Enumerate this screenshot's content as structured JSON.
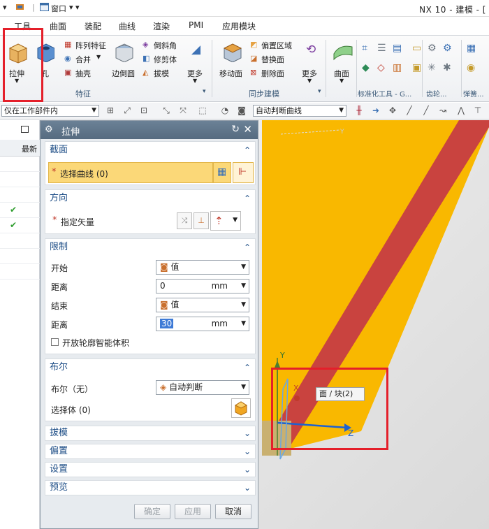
{
  "titlebar": {
    "title": "NX 10 - 建模 - [",
    "window_menu": "窗口"
  },
  "menu_tabs": [
    "工具",
    "曲面",
    "装配",
    "曲线",
    "渲染",
    "PMI",
    "应用模块"
  ],
  "ribbon": {
    "extrude": "拉伸",
    "hole": "孔",
    "pattern_feature": "阵列特征",
    "unite": "合并",
    "shell": "抽壳",
    "feature_group": "特征",
    "edge_blend": "边倒圆",
    "chamfer": "倒斜角",
    "trim_body": "修剪体",
    "draft": "拔模",
    "more1": "更多",
    "move_face": "移动面",
    "offset_region": "偏置区域",
    "replace_face": "替换面",
    "delete_face": "删除面",
    "sync_group": "同步建模",
    "more2": "更多",
    "surface": "曲面",
    "std_group": "标准化工具 - G...",
    "gear_group": "齿轮...",
    "spring_group": "弹簧..."
  },
  "selbar": {
    "filter": "仅在工作部件内",
    "curve_rule": "自动判断曲线"
  },
  "nav": {
    "col_header": "最新",
    "check1": "✔",
    "check2": "✔"
  },
  "dialog": {
    "title": "拉伸",
    "section_label": "截面",
    "select_curve": "选择曲线 (0)",
    "direction_label": "方向",
    "specify_vector": "指定矢量",
    "limits_label": "限制",
    "start_label": "开始",
    "start_value": "值",
    "distance_label": "距离",
    "start_distance": "0",
    "unit1": "mm",
    "end_label": "结束",
    "end_value": "值",
    "end_distance_label": "距离",
    "end_distance": "30",
    "unit2": "mm",
    "open_profile": "开放轮廓智能体积",
    "boolean_label": "布尔",
    "boolean_none": "布尔（无）",
    "boolean_value": "自动判断",
    "select_body": "选择体 (0)",
    "draft": "拔模",
    "offset": "偏置",
    "settings": "设置",
    "preview": "预览",
    "ok": "确定",
    "apply": "应用",
    "cancel": "取消"
  },
  "viewport": {
    "tooltip": "面 / 块(2)",
    "axis_x": "X",
    "axis_y": "Y",
    "axis_z": "Z",
    "axis_y_top": "Y"
  },
  "colors": {
    "face_yellow": "#f9b800",
    "face_red": "#c9433f",
    "highlight_red": "#e41f2a",
    "dialog_title": "#5d7286",
    "selection_yellow": "#fbd878"
  }
}
